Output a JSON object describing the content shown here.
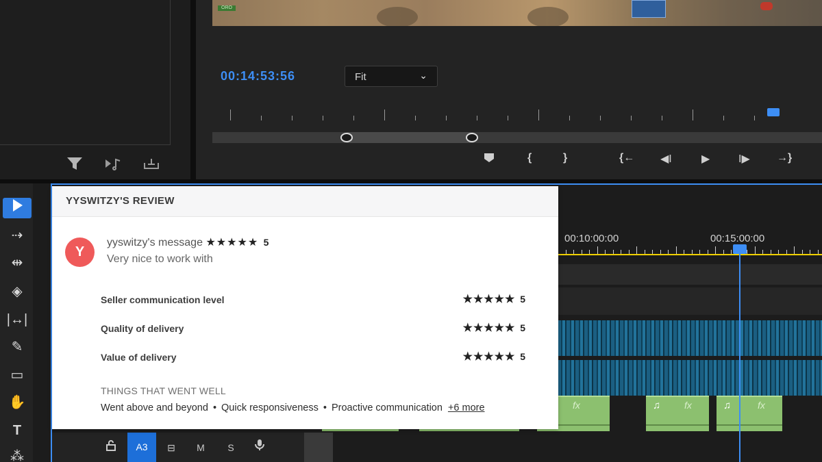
{
  "monitor": {
    "hud_badge": "ORO",
    "timecode": "00:14:53:56",
    "zoom_select": "Fit"
  },
  "timeline": {
    "ruler_times": [
      "00:10:00:00",
      "00:15:00:00"
    ],
    "track_header": {
      "active_track": "A3",
      "m_label": "M",
      "s_label": "S"
    }
  },
  "review": {
    "header": "YYSWITZY'S REVIEW",
    "avatar_letter": "Y",
    "message_title": "yyswitzy's message",
    "message_stars": "★★★★★",
    "message_score": "5",
    "message_text": "Very nice to work with",
    "ratings": [
      {
        "label": "Seller communication level",
        "stars": "★★★★★",
        "score": "5"
      },
      {
        "label": "Quality of delivery",
        "stars": "★★★★★",
        "score": "5"
      },
      {
        "label": "Value of delivery",
        "stars": "★★★★★",
        "score": "5"
      }
    ],
    "went_well_title": "THINGS THAT WENT WELL",
    "went_well": [
      "Went above and beyond",
      "Quick responsiveness",
      "Proactive communication"
    ],
    "more_link": "+6 more"
  },
  "colors": {
    "accent_blue": "#3d8ef5",
    "avatar_red": "#ef5a5a",
    "audio_green": "#8cc06f",
    "ruler_yellow": "#f0d000"
  }
}
